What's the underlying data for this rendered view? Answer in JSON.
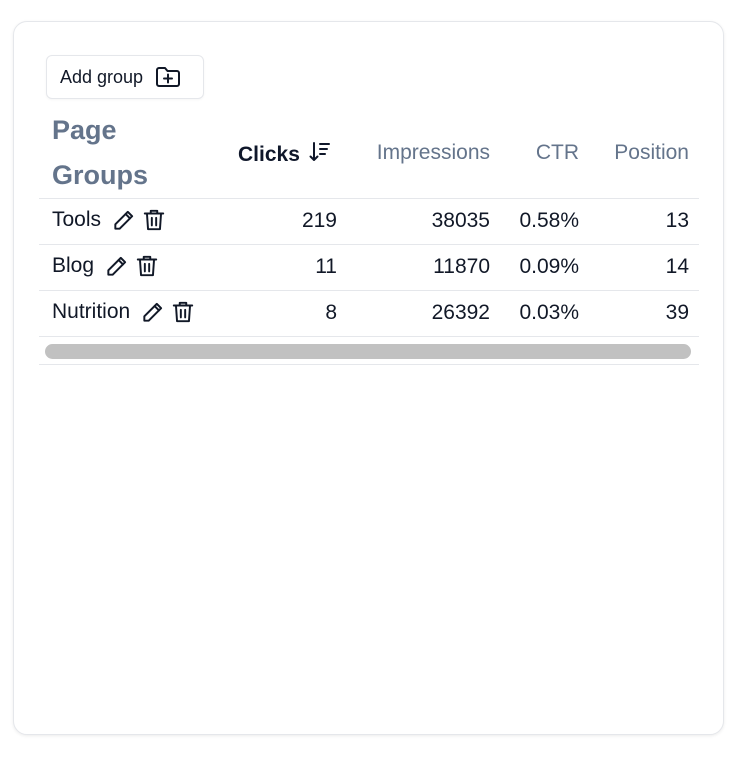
{
  "toolbar": {
    "add_group_label": "Add group",
    "add_group_icon": "folder-plus-icon"
  },
  "table": {
    "headers": {
      "group_line1": "Page",
      "group_line2": "Groups",
      "clicks": "Clicks",
      "impressions": "Impressions",
      "ctr": "CTR",
      "position": "Position"
    },
    "sort": {
      "column": "clicks",
      "direction": "descending",
      "icon": "sort-descending-icon"
    },
    "rows": [
      {
        "name": "Tools",
        "clicks": "219",
        "impressions": "38035",
        "ctr": "0.58%",
        "position": "13"
      },
      {
        "name": "Blog",
        "clicks": "11",
        "impressions": "11870",
        "ctr": "0.09%",
        "position": "14"
      },
      {
        "name": "Nutrition",
        "clicks": "8",
        "impressions": "26392",
        "ctr": "0.03%",
        "position": "39"
      }
    ],
    "row_icons": [
      "pencil-icon",
      "trash-icon"
    ]
  },
  "colors": {
    "header_muted": "#64748b",
    "text": "#0f172a",
    "border": "#e5e7eb",
    "scrollbar": "#c1c1c1"
  }
}
